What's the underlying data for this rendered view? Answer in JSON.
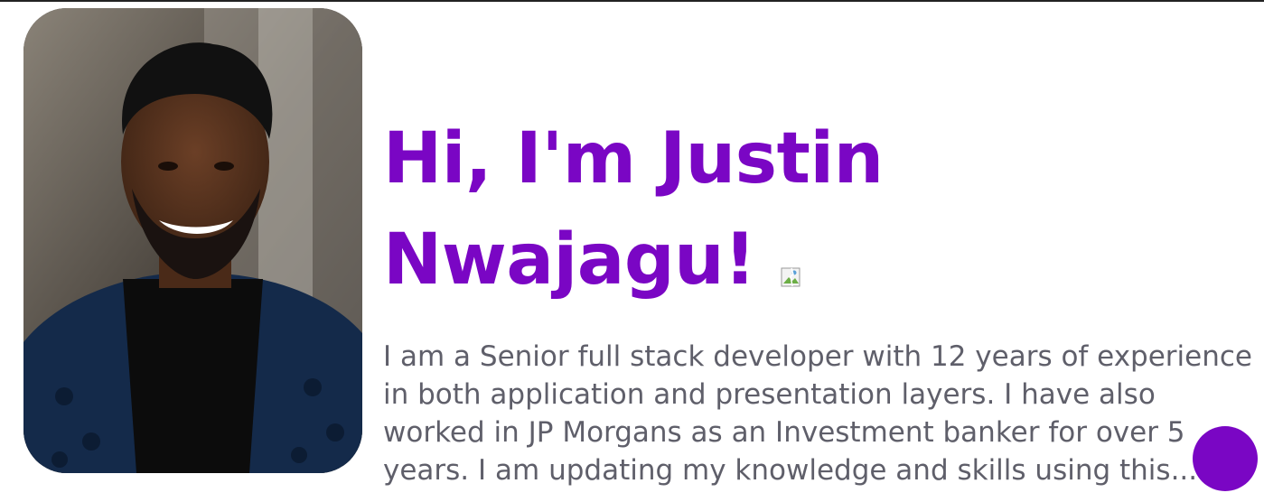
{
  "hero": {
    "title_line1": "Hi, I'm Justin",
    "title_line2": "Nwajagu!",
    "wave_icon": "broken-image-icon",
    "bio": "I am a Senior full stack developer with 12 years of experience in both application and presentation layers. I have also worked in JP Morgans as an Investment banker for over 5 years. I am updating my knowledge and skills using this..."
  },
  "portrait": {
    "alt": "profile photo"
  },
  "colors": {
    "accent": "#7a06c4",
    "bio_text": "#5f5f6a",
    "background": "#ffffff"
  }
}
